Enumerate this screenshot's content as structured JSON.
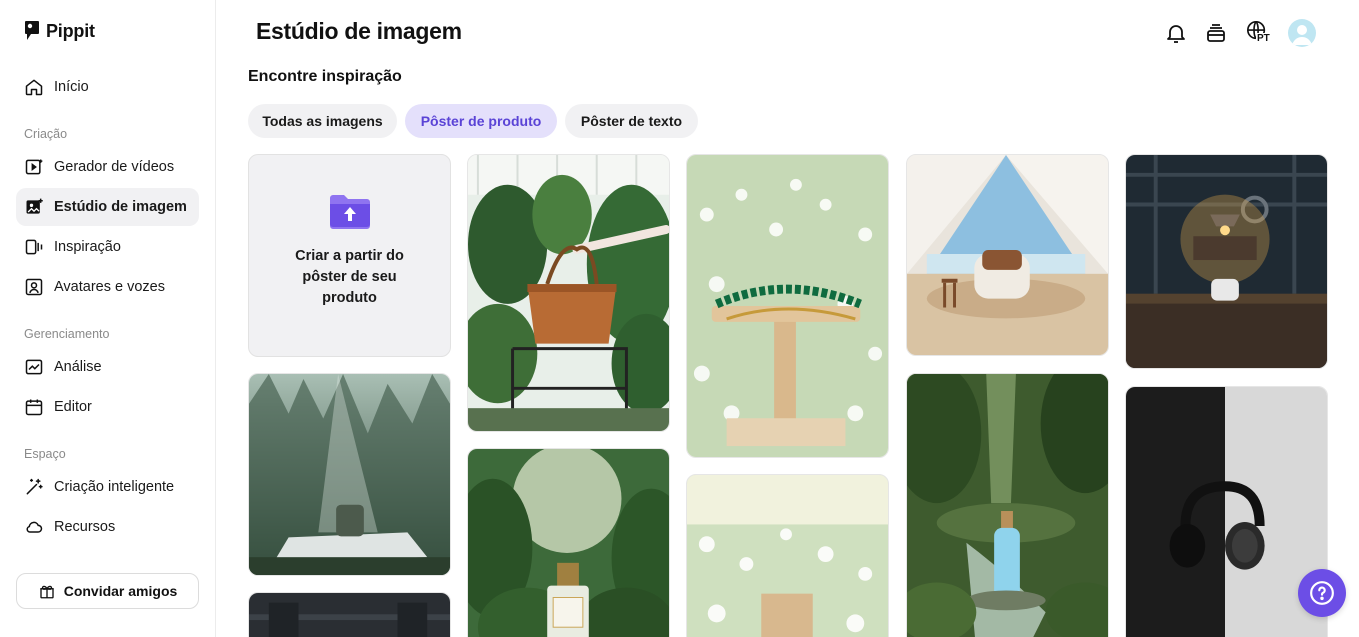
{
  "app": {
    "name": "Pippit"
  },
  "sidebar": {
    "items": [
      {
        "label": "Início",
        "icon": "home-icon"
      },
      {
        "label": "Gerador de vídeos",
        "icon": "video-plus-icon"
      },
      {
        "label": "Estúdio de imagem",
        "icon": "image-studio-icon",
        "active": true
      },
      {
        "label": "Inspiração",
        "icon": "inspiration-icon"
      },
      {
        "label": "Avatares e vozes",
        "icon": "avatar-icon"
      },
      {
        "label": "Análise",
        "icon": "analytics-icon"
      },
      {
        "label": "Editor",
        "icon": "calendar-icon"
      },
      {
        "label": "Criação inteligente",
        "icon": "magic-wand-icon"
      },
      {
        "label": "Recursos",
        "icon": "cloud-icon"
      }
    ],
    "sections": [
      "Criação",
      "Gerenciamento",
      "Espaço"
    ],
    "invite_label": "Convidar amigos"
  },
  "header": {
    "title": "Estúdio de imagem",
    "language": "PT",
    "icons": [
      "bell-icon",
      "stack-icon",
      "globe-icon",
      "avatar"
    ]
  },
  "main": {
    "subtitle": "Encontre inspiração",
    "filters": [
      {
        "label": "Todas as imagens",
        "active": false
      },
      {
        "label": "Pôster de produto",
        "active": true
      },
      {
        "label": "Pôster de texto",
        "active": false
      }
    ],
    "upload_card": {
      "text": "Criar a partir do pôster de seu produto"
    }
  },
  "colors": {
    "accent": "#6c4ee6",
    "chip_active_bg": "#e4e0fb",
    "chip_bg": "#f1f1f3"
  }
}
